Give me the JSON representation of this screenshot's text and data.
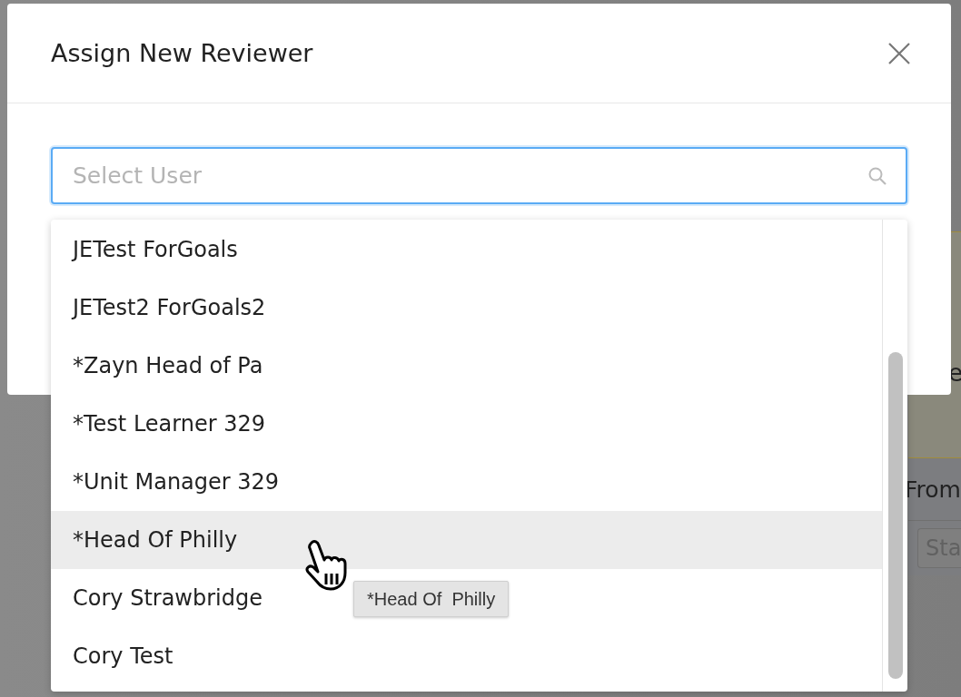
{
  "background": {
    "note": "e",
    "column_label": "From",
    "field_placeholder": "Sta"
  },
  "dialog": {
    "title": "Assign New Reviewer",
    "search": {
      "placeholder": "Select User",
      "focused": true
    },
    "options": [
      {
        "label": "JETest ForGoals",
        "hovered": false
      },
      {
        "label": "JETest2 ForGoals2",
        "hovered": false
      },
      {
        "label": "*Zayn Head of Pa",
        "hovered": false
      },
      {
        "label": "*Test Learner 329",
        "hovered": false
      },
      {
        "label": "*Unit Manager 329",
        "hovered": false
      },
      {
        "label": "*Head Of Philly",
        "hovered": true
      },
      {
        "label": "Cory Strawbridge",
        "hovered": false
      },
      {
        "label": "Cory Test",
        "hovered": false
      }
    ],
    "tooltip": "*Head Of  Philly"
  }
}
